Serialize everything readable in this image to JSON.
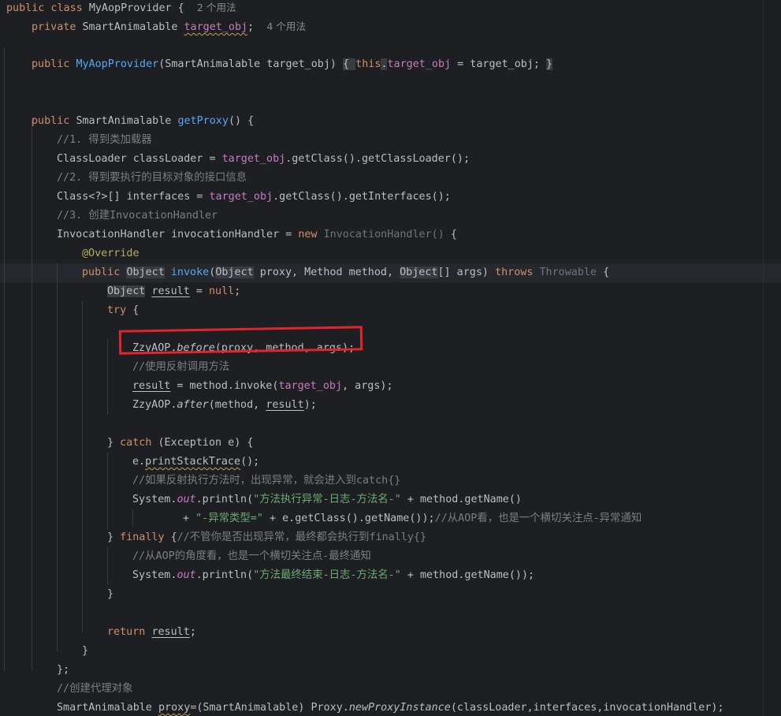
{
  "colors": {
    "background": "#1e1f22",
    "keyword": "#cf8e6d",
    "method": "#56a8f5",
    "field": "#c77dbb",
    "comment": "#7a7e85",
    "string": "#6aab73",
    "annotation": "#b3ae60",
    "annotation_box": "#e1252c"
  },
  "lines": [
    {
      "indent": 0,
      "tokens": [
        [
          "public class ",
          "kw"
        ],
        [
          "MyAopProvider {  ",
          ""
        ],
        [
          "2 个用法",
          "hint"
        ]
      ]
    },
    {
      "indent": 1,
      "tokens": [
        [
          "private ",
          "kw"
        ],
        [
          "SmartAnimalable ",
          ""
        ],
        [
          "target_obj",
          "fld-wavy"
        ],
        [
          ";  ",
          ""
        ],
        [
          "4 个用法",
          "hint"
        ]
      ]
    },
    {
      "indent": 0,
      "tokens": []
    },
    {
      "indent": 1,
      "tokens": [
        [
          "public ",
          "kw"
        ],
        [
          "MyAopProvider",
          "fn"
        ],
        [
          "(SmartAnimalable target_obj) ",
          ""
        ],
        [
          "{ ",
          "fold"
        ],
        [
          "this",
          "kw"
        ],
        [
          ".",
          "fold"
        ],
        [
          "target_obj",
          "fld"
        ],
        [
          " = target_obj; ",
          ""
        ],
        [
          "}",
          "fold"
        ]
      ]
    },
    {
      "indent": 0,
      "tokens": []
    },
    {
      "indent": 0,
      "tokens": []
    },
    {
      "indent": 1,
      "tokens": [
        [
          "public ",
          "kw"
        ],
        [
          "SmartAnimalable ",
          ""
        ],
        [
          "getProxy",
          "fn"
        ],
        [
          "() {",
          ""
        ]
      ]
    },
    {
      "indent": 2,
      "tokens": [
        [
          "//1. 得到类加载器",
          "cm"
        ]
      ]
    },
    {
      "indent": 2,
      "tokens": [
        [
          "ClassLoader classLoader = ",
          ""
        ],
        [
          "target_obj",
          "fld"
        ],
        [
          ".getClass().getClassLoader();",
          ""
        ]
      ]
    },
    {
      "indent": 2,
      "tokens": [
        [
          "//2. 得到要执行的目标对象的接口信息",
          "cm"
        ]
      ]
    },
    {
      "indent": 2,
      "tokens": [
        [
          "Class<?>[] interfaces = ",
          ""
        ],
        [
          "target_obj",
          "fld"
        ],
        [
          ".getClass().getInterfaces();",
          ""
        ]
      ]
    },
    {
      "indent": 2,
      "tokens": [
        [
          "//3. 创建InvocationHandler",
          "cm"
        ]
      ]
    },
    {
      "indent": 2,
      "tokens": [
        [
          "InvocationHandler invocationHandler = ",
          ""
        ],
        [
          "new ",
          "kw"
        ],
        [
          "InvocationHandler() ",
          "dim"
        ],
        [
          "{",
          ""
        ]
      ]
    },
    {
      "indent": 3,
      "tokens": [
        [
          "@Override",
          "ann"
        ]
      ]
    },
    {
      "indent": 3,
      "tokens": [
        [
          "public ",
          "kw"
        ],
        [
          "Object",
          "box"
        ],
        [
          " ",
          ""
        ],
        [
          "invoke",
          "fn"
        ],
        [
          "(",
          ""
        ],
        [
          "Object",
          "box"
        ],
        [
          " proxy, Method method, ",
          ""
        ],
        [
          "Object",
          "box"
        ],
        [
          "[] args) ",
          ""
        ],
        [
          "throws ",
          "kw"
        ],
        [
          "Throwable ",
          "dim"
        ],
        [
          "{",
          ""
        ]
      ]
    },
    {
      "indent": 4,
      "tokens": [
        [
          "Object",
          "box"
        ],
        [
          " ",
          ""
        ],
        [
          "result",
          "under"
        ],
        [
          " = ",
          ""
        ],
        [
          "null",
          "kw"
        ],
        [
          ";",
          ""
        ]
      ]
    },
    {
      "indent": 4,
      "tokens": [
        [
          "try ",
          "kw"
        ],
        [
          "{",
          ""
        ]
      ]
    },
    {
      "indent": 0,
      "tokens": []
    },
    {
      "indent": 5,
      "tokens": [
        [
          "ZzyAOP.",
          ""
        ],
        [
          "before",
          "it"
        ],
        [
          "(proxy, method, args);",
          ""
        ]
      ]
    },
    {
      "indent": 5,
      "tokens": [
        [
          "//使用反射调用方法",
          "cm"
        ]
      ]
    },
    {
      "indent": 5,
      "tokens": [
        [
          "result",
          "under"
        ],
        [
          " = method.invoke(",
          ""
        ],
        [
          "target_obj",
          "fld"
        ],
        [
          ", args);",
          ""
        ]
      ]
    },
    {
      "indent": 5,
      "tokens": [
        [
          "ZzyAOP.",
          ""
        ],
        [
          "after",
          "it"
        ],
        [
          "(method, ",
          ""
        ],
        [
          "result",
          "under"
        ],
        [
          ");",
          ""
        ]
      ]
    },
    {
      "indent": 0,
      "tokens": []
    },
    {
      "indent": 4,
      "tokens": [
        [
          "} ",
          ""
        ],
        [
          "catch ",
          "kw"
        ],
        [
          "(Exception e) {",
          ""
        ]
      ]
    },
    {
      "indent": 5,
      "tokens": [
        [
          "e.",
          ""
        ],
        [
          "printStackTrace",
          "wavy"
        ],
        [
          "();",
          ""
        ]
      ]
    },
    {
      "indent": 5,
      "tokens": [
        [
          "//如果反射执行方法时，出现异常，就会进入到catch{}",
          "cm"
        ]
      ]
    },
    {
      "indent": 5,
      "tokens": [
        [
          "System.",
          ""
        ],
        [
          "out",
          "sfld"
        ],
        [
          ".println(",
          ""
        ],
        [
          "\"方法执行异常-日志-方法名-\"",
          "str"
        ],
        [
          " + method.getName()",
          ""
        ]
      ]
    },
    {
      "indent": 7,
      "tokens": [
        [
          "+ ",
          ""
        ],
        [
          "\"-异常类型=\"",
          "str"
        ],
        [
          " + e.getClass().getName());",
          ""
        ],
        [
          "//从AOP看，也是一个横切关注点-异常通知",
          "cm"
        ]
      ]
    },
    {
      "indent": 4,
      "tokens": [
        [
          "} ",
          ""
        ],
        [
          "finally ",
          "kw"
        ],
        [
          "{",
          ""
        ],
        [
          "//不管你是否出现异常，最终都会执行到finally{}",
          "cm"
        ]
      ]
    },
    {
      "indent": 5,
      "tokens": [
        [
          "//从AOP的角度看，也是一个横切关注点-最终通知",
          "cm"
        ]
      ]
    },
    {
      "indent": 5,
      "tokens": [
        [
          "System.",
          ""
        ],
        [
          "out",
          "sfld"
        ],
        [
          ".println(",
          ""
        ],
        [
          "\"方法最终结束-日志-方法名-\"",
          "str"
        ],
        [
          " + method.getName());",
          ""
        ]
      ]
    },
    {
      "indent": 4,
      "tokens": [
        [
          "}",
          ""
        ]
      ]
    },
    {
      "indent": 0,
      "tokens": []
    },
    {
      "indent": 4,
      "tokens": [
        [
          "return ",
          "kw"
        ],
        [
          "result",
          "under"
        ],
        [
          ";",
          ""
        ]
      ]
    },
    {
      "indent": 3,
      "tokens": [
        [
          "}",
          ""
        ]
      ]
    },
    {
      "indent": 2,
      "tokens": [
        [
          "};",
          ""
        ]
      ]
    },
    {
      "indent": 2,
      "tokens": [
        [
          "//创建代理对象",
          "cm"
        ]
      ]
    },
    {
      "indent": 2,
      "tokens": [
        [
          "SmartAnimalable ",
          ""
        ],
        [
          "proxy",
          "wavy"
        ],
        [
          "=(SmartAnimalable) Proxy.",
          ""
        ],
        [
          "newProxyInstance",
          "it"
        ],
        [
          "(classLoader,interfaces,invocationHandler);",
          ""
        ]
      ]
    }
  ]
}
